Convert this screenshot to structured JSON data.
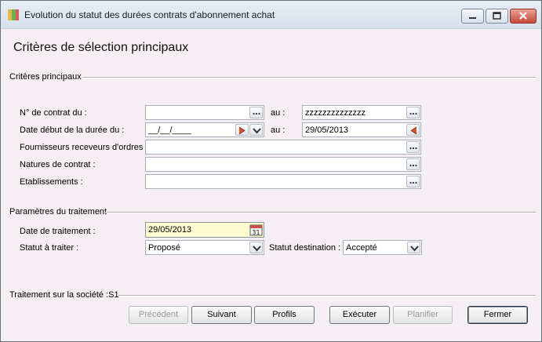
{
  "window": {
    "title": "Evolution du statut des durées contrats d'abonnement achat",
    "icon": "app-icon",
    "controls": [
      "minimize-icon",
      "maximize-icon",
      "close-icon"
    ]
  },
  "heading": "Critères de sélection principaux",
  "criteria": {
    "section_label": "Critères principaux",
    "contract_from_label": "N° de contrat du :",
    "contract_from_value": "",
    "contract_to_label": "au :",
    "contract_to_value": "zzzzzzzzzzzzzz",
    "start_date_label": "Date début de la durée du :",
    "start_date_from_value": "__/__/____",
    "start_date_to_label": "au :",
    "start_date_to_value": "29/05/2013",
    "suppliers_label": "Fournisseurs receveurs d'ordres :",
    "suppliers_value": "",
    "contract_types_label": "Natures de contrat :",
    "contract_types_value": "",
    "establishments_label": "Etablissements :",
    "establishments_value": ""
  },
  "processing": {
    "section_label": "Paramètres du traitement",
    "date_label": "Date de traitement :",
    "date_value": "29/05/2013",
    "status_label": "Statut à traiter :",
    "status_value": "Proposé",
    "dest_status_label": "Statut destination :",
    "dest_status_value": "Accepté",
    "calendar_icon_text": "31"
  },
  "footer": {
    "company_label": "Traitement sur la société :S1"
  },
  "buttons": {
    "previous": "Précédent",
    "next": "Suivant",
    "profiles": "Profils",
    "execute": "Exécuter",
    "schedule": "Planifier",
    "close": "Fermer"
  },
  "colors": {
    "background": "#f5eef2",
    "highlight_field": "#fdfbd0",
    "title_bar": "#dbe4ef",
    "close_button": "#c74a3a"
  }
}
